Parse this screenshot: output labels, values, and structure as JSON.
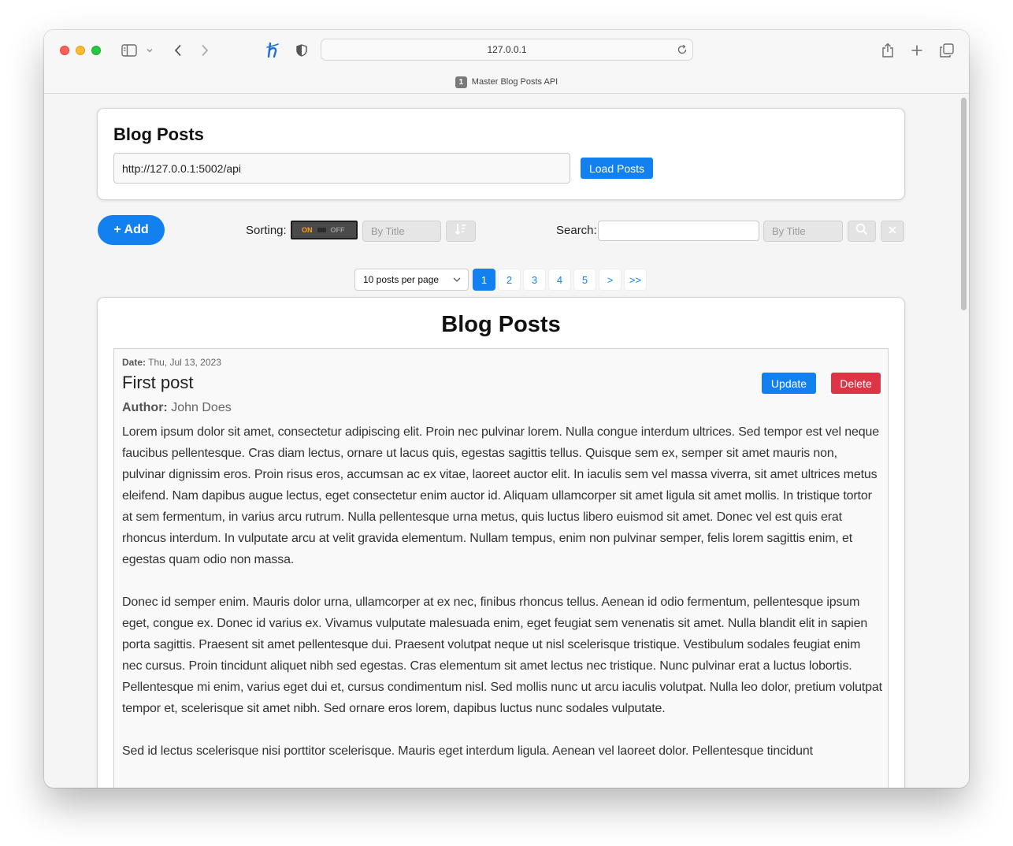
{
  "browser": {
    "address": "127.0.0.1",
    "tab_badge": "1",
    "tab_title": "Master Blog Posts API"
  },
  "header_card": {
    "title": "Blog Posts",
    "api_url": "http://127.0.0.1:5002/api",
    "load_button": "Load Posts"
  },
  "controls": {
    "add_button": "+ Add",
    "sorting_label": "Sorting:",
    "toggle_on": "ON",
    "toggle_off": "OFF",
    "sort_field": "By Title",
    "search_label": "Search:",
    "search_value": "",
    "search_field": "By Title"
  },
  "pagination": {
    "per_page": "10 posts per page",
    "pages": [
      "1",
      "2",
      "3",
      "4",
      "5",
      ">",
      ">>"
    ],
    "current": "1"
  },
  "posts_section": {
    "title": "Blog Posts"
  },
  "post": {
    "date_label": "Date:",
    "date": "Thu, Jul 13, 2023",
    "title": "First post",
    "update_button": "Update",
    "delete_button": "Delete",
    "author_label": "Author:",
    "author": "John Does",
    "paragraphs": [
      "Lorem ipsum dolor sit amet, consectetur adipiscing elit. Proin nec pulvinar lorem. Nulla congue interdum ultrices. Sed tempor est vel neque faucibus pellentesque. Cras diam lectus, ornare ut lacus quis, egestas sagittis tellus. Quisque sem ex, semper sit amet mauris non, pulvinar dignissim eros. Proin risus eros, accumsan ac ex vitae, laoreet auctor elit. In iaculis sem vel massa viverra, sit amet ultrices metus eleifend. Nam dapibus augue lectus, eget consectetur enim auctor id. Aliquam ullamcorper sit amet ligula sit amet mollis. In tristique tortor at sem fermentum, in varius arcu rutrum. Nulla pellentesque urna metus, quis luctus libero euismod sit amet. Donec vel est quis erat rhoncus interdum. In vulputate arcu at velit gravida elementum. Nullam tempus, enim non pulvinar semper, felis lorem sagittis enim, et egestas quam odio non massa.",
      "Donec id semper enim. Mauris dolor urna, ullamcorper at ex nec, finibus rhoncus tellus. Aenean id odio fermentum, pellentesque ipsum eget, congue ex. Donec id varius ex. Vivamus vulputate malesuada enim, eget feugiat sem venenatis sit amet. Nulla blandit elit in sapien porta sagittis. Praesent sit amet pellentesque dui. Praesent volutpat neque ut nisl scelerisque tristique. Vestibulum sodales feugiat enim nec cursus. Proin tincidunt aliquet nibh sed egestas. Cras elementum sit amet lectus nec tristique. Nunc pulvinar erat a luctus lobortis. Pellentesque mi enim, varius eget dui et, cursus condimentum nisl. Sed mollis nunc ut arcu iaculis volutpat. Nulla leo dolor, pretium volutpat tempor et, scelerisque sit amet nibh. Sed ornare eros lorem, dapibus luctus nunc sodales vulputate.",
      "Sed id lectus scelerisque nisi porttitor scelerisque. Mauris eget interdum ligula. Aenean vel laoreet dolor. Pellentesque tincidunt"
    ]
  },
  "icons": {
    "sidebar": "sidebar-icon",
    "back": "chevron-left-icon",
    "forward": "chevron-right-icon",
    "extension": "honey-h-icon",
    "privacy": "shield-icon",
    "reload": "reload-icon",
    "share": "share-icon",
    "new_tab": "plus-icon",
    "tabs": "tab-overview-icon",
    "sort_direction": "sort-descending-icon",
    "search": "magnifier-icon",
    "clear": "close-icon"
  },
  "colors": {
    "accent": "#1380f0",
    "danger": "#dc3545",
    "toggle_on": "#ff9f1a"
  }
}
